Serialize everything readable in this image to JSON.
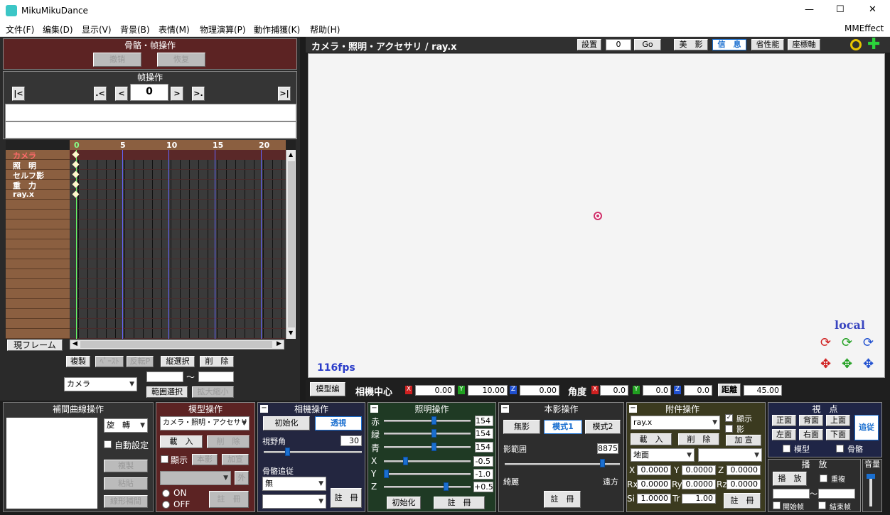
{
  "window": {
    "title": "MikuMikuDance",
    "min": "—",
    "max": "☐",
    "close": "✕"
  },
  "menu": [
    "文件(F)",
    "编集(D)",
    "显示(V)",
    "背景(B)",
    "表情(M)",
    "物理演算(P)",
    "動作捕獲(K)",
    "帮助(H)"
  ],
  "mmeffect": "MMEffect",
  "bone_panel": {
    "title": "骨骼・帧操作",
    "undo": "撤销",
    "redo": "恢复"
  },
  "frame_panel": {
    "title": "帧操作",
    "first": "|<",
    "prev_key": ".<",
    "prev": "<",
    "frame": "0",
    "next": ">",
    "next_key": ">.",
    "last": ">|"
  },
  "timeline": {
    "ticks": [
      "0",
      "5",
      "10",
      "15",
      "20"
    ],
    "rows": [
      "カメラ",
      "照　明",
      "セルフ影",
      "重　力",
      "ray.x"
    ],
    "current_frame_btn": "現フレーム"
  },
  "edit_buttons": {
    "copy": "複製",
    "paste": "ﾍﾟｰｽﾄ",
    "reverse": "反転P",
    "vsel": "縦選択",
    "delete": "削　除",
    "range_sel": "範囲選択",
    "expand": "拡大縮小",
    "tilde": "～"
  },
  "target_select": "カメラ",
  "viewport": {
    "title": "カメラ・照明・アクセサリ / ray.x",
    "setup": "設置",
    "setup_value": "0",
    "go": "Go",
    "beauty": "美　影",
    "info": "信　息",
    "perf": "省性能",
    "axis": "座標軸",
    "fps": "116fps",
    "local": "local"
  },
  "camera_bar": {
    "model_edit": "模型編",
    "center_label": "相機中心",
    "x": "0.00",
    "y": "10.00",
    "z": "0.00",
    "angle_label": "角度",
    "ax": "0.0",
    "ay": "0.0",
    "az": "0.0",
    "dist_label": "距離",
    "dist": "45.00",
    "xl": "X",
    "yl": "Y",
    "zl": "Z"
  },
  "interp": {
    "title": "補間曲線操作",
    "select": "旋　轉",
    "auto": "自動設定",
    "copy": "複製",
    "paste": "粘貼",
    "linear": "線形補間"
  },
  "model_op": {
    "title": "模型操作",
    "select": "カメラ・照明・アクセサリ",
    "load": "載　入",
    "delete": "削　除",
    "show": "顯示",
    "shadow": "本影",
    "add": "加宣",
    "ext": "外",
    "on": "ON",
    "off": "OFF",
    "register": "註　冊"
  },
  "camera_op": {
    "title": "相機操作",
    "init": "初始化",
    "persp": "透視",
    "fov_label": "視野角",
    "fov": "30",
    "follow_label": "骨骼追従",
    "follow": "無",
    "register": "註　冊"
  },
  "light_op": {
    "title": "照明操作",
    "r_label": "赤",
    "g_label": "緑",
    "b_label": "青",
    "r": "154",
    "g": "154",
    "b": "154",
    "x_label": "X",
    "y_label": "Y",
    "z_label": "Z",
    "x": "-0.5",
    "y": "-1.0",
    "z": "+0.5",
    "init": "初始化",
    "register": "註　冊"
  },
  "shadow_op": {
    "title": "本影操作",
    "none": "無影",
    "mode1": "模式1",
    "mode2": "模式2",
    "range_label": "影範囲",
    "range": "8875",
    "near": "綺麗",
    "far": "遠方",
    "register": "註　冊"
  },
  "acc_op": {
    "title": "附件操作",
    "select": "ray.x",
    "show": "顯示",
    "shadow": "影",
    "load": "載　入",
    "delete": "削　除",
    "add": "加 宣",
    "ground": "地面",
    "x": "0.0000",
    "y": "0.0000",
    "z": "0.0000",
    "rx": "0.0000",
    "ry": "0.0000",
    "rz": "0.0000",
    "si": "1.0000",
    "tr": "1.00",
    "register": "註　冊",
    "xl": "X",
    "yl": "Y",
    "zl": "Z",
    "rxl": "Rx",
    "ryl": "Ry",
    "rzl": "Rz",
    "sil": "Si",
    "trl": "Tr"
  },
  "view_op": {
    "title": "視　点",
    "front": "正面",
    "back": "背面",
    "top": "上面",
    "left": "左面",
    "right": "右面",
    "bottom": "下面",
    "follow": "追従",
    "model": "模型",
    "bone": "骨骼"
  },
  "play_op": {
    "title": "播　放",
    "play": "播　放",
    "repeat": "重複",
    "start": "開始帧",
    "end": "結束帧",
    "tilde": "～",
    "volume": "音量"
  },
  "colors": {
    "accent_blue": "#1a6fd0",
    "dark_red": "#5a1a1a",
    "viewport_bg": "#f4f4f4"
  }
}
